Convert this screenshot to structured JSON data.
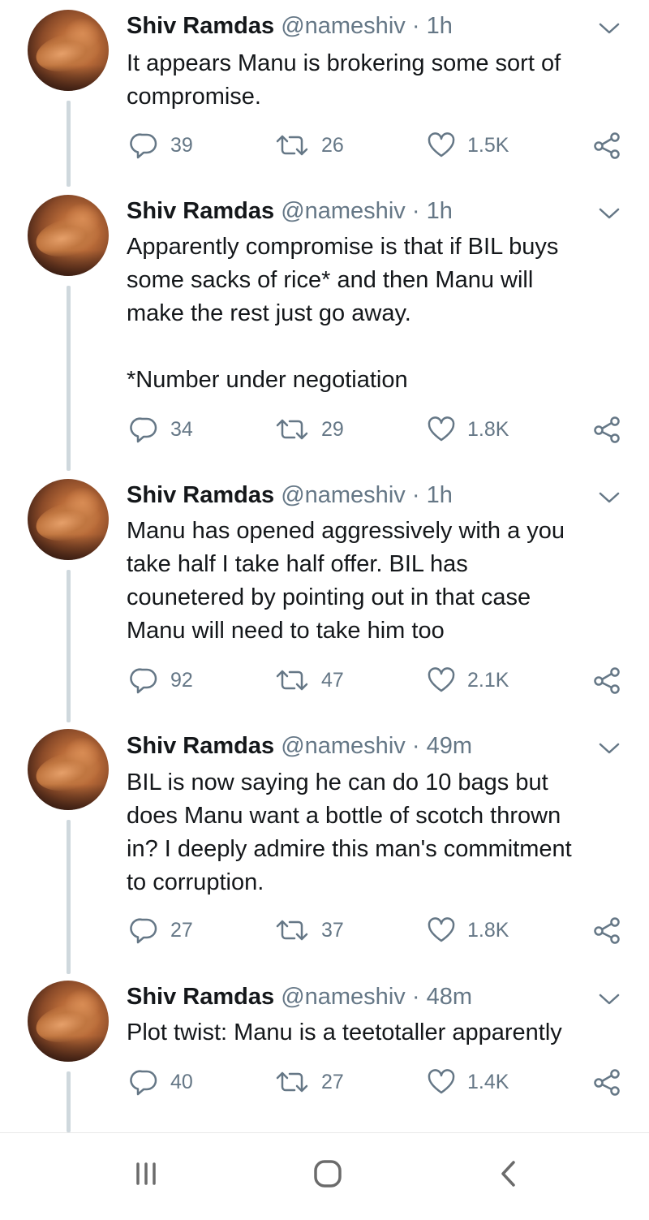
{
  "tweets": [
    {
      "name": "Shiv Ramdas",
      "handle": "@nameshiv",
      "separator": "·",
      "time": "1h",
      "text": "It appears Manu is brokering some sort of\ncompromise.",
      "note": "",
      "replies": "39",
      "retweets": "26",
      "likes": "1.5K"
    },
    {
      "name": "Shiv Ramdas",
      "handle": "@nameshiv",
      "separator": "·",
      "time": "1h",
      "text": "Apparently compromise is that if BIL buys\nsome sacks of rice* and then Manu will\nmake the rest just go away.",
      "note": "*Number under negotiation",
      "replies": "34",
      "retweets": "29",
      "likes": "1.8K"
    },
    {
      "name": "Shiv Ramdas",
      "handle": "@nameshiv",
      "separator": "·",
      "time": "1h",
      "text": "Manu has opened aggressively with a you\ntake half I take half offer. BIL has\ncounetered by pointing out in that case\nManu will need to take him too",
      "note": "",
      "replies": "92",
      "retweets": "47",
      "likes": "2.1K"
    },
    {
      "name": "Shiv Ramdas",
      "handle": "@nameshiv",
      "separator": "·",
      "time": "49m",
      "text": "BIL is now saying he can do 10 bags but\ndoes Manu want a bottle of scotch thrown\nin? I deeply admire this man's commitment\nto corruption.",
      "note": "",
      "replies": "27",
      "retweets": "37",
      "likes": "1.8K"
    },
    {
      "name": "Shiv Ramdas",
      "handle": "@nameshiv",
      "separator": "·",
      "time": "48m",
      "text": "Plot twist: Manu is a teetotaller apparently",
      "note": "",
      "replies": "40",
      "retweets": "27",
      "likes": "1.4K"
    }
  ],
  "icons": {
    "reply": "reply-icon",
    "retweet": "retweet-icon",
    "like": "heart-icon",
    "share": "share-icon",
    "menu": "chevron-down-icon"
  },
  "navbar": {
    "recents": "recent-apps-icon",
    "home": "home-icon",
    "back": "back-icon"
  },
  "colors": {
    "text": "#14171a",
    "secondary": "#657786",
    "thread_line": "#cfd8dd"
  }
}
